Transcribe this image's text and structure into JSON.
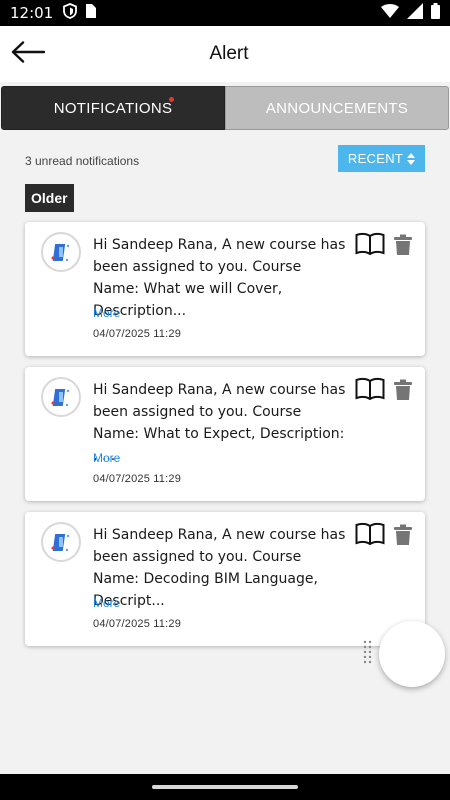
{
  "status_bar": {
    "time": "12:01",
    "icons": [
      "shield-icon",
      "sim-icon",
      "wifi-icon",
      "signal-icon",
      "battery-icon"
    ]
  },
  "header": {
    "title": "Alert",
    "back_icon": "arrow-left-icon"
  },
  "tabs": [
    {
      "label": "NOTIFICATIONS",
      "active": true,
      "has_dot": true
    },
    {
      "label": "ANNOUNCEMENTS",
      "active": false
    }
  ],
  "summary": {
    "unread_text": "3 unread notifications",
    "sort_label": "RECENT"
  },
  "section_label": "Older",
  "notifications": [
    {
      "message": "Hi Sandeep Rana, A new course has been assigned to you. Course Name: What we will Cover, Description...",
      "more": "More",
      "timestamp": "04/07/2025 11:29"
    },
    {
      "message": "Hi Sandeep Rana, A new course has been assigned to you. Course Name: What to Expect, Description: , ...",
      "more": "More",
      "timestamp": "04/07/2025 11:29"
    },
    {
      "message": "Hi Sandeep Rana, A new course has been assigned to you. Course Name: Decoding BIM Language, Descript...",
      "more": "More",
      "timestamp": "04/07/2025 11:29"
    }
  ],
  "colors": {
    "accent": "#4db6ec",
    "link": "#1e88e5",
    "active_tab": "#2b2b2b",
    "inactive_tab": "#bdbdbd",
    "unread_dot": "#e53935"
  }
}
